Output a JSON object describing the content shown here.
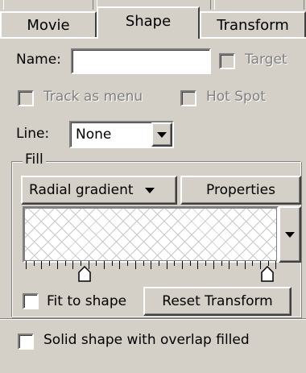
{
  "tabs": [
    {
      "label": "Movie",
      "active": false
    },
    {
      "label": "Shape",
      "active": true
    },
    {
      "label": "Transform",
      "active": false
    }
  ],
  "name_field": {
    "label": "Name:",
    "value": ""
  },
  "target": {
    "label": "Target",
    "checked": false,
    "enabled": false
  },
  "track_as_menu": {
    "label": "Track as menu",
    "checked": false,
    "enabled": false
  },
  "hot_spot": {
    "label": "Hot Spot",
    "checked": false,
    "enabled": false
  },
  "line": {
    "label": "Line:",
    "value": "None"
  },
  "fill": {
    "legend": "Fill",
    "type_value": "Radial gradient",
    "properties_label": "Properties",
    "fit_to_shape": {
      "label": "Fit to shape",
      "checked": false
    },
    "reset_transform_label": "Reset Transform"
  },
  "solid_shape": {
    "label": "Solid shape with overlap filled",
    "checked": false
  },
  "colors": {
    "face": "#d4d0c8",
    "disabled_text": "#808080"
  }
}
